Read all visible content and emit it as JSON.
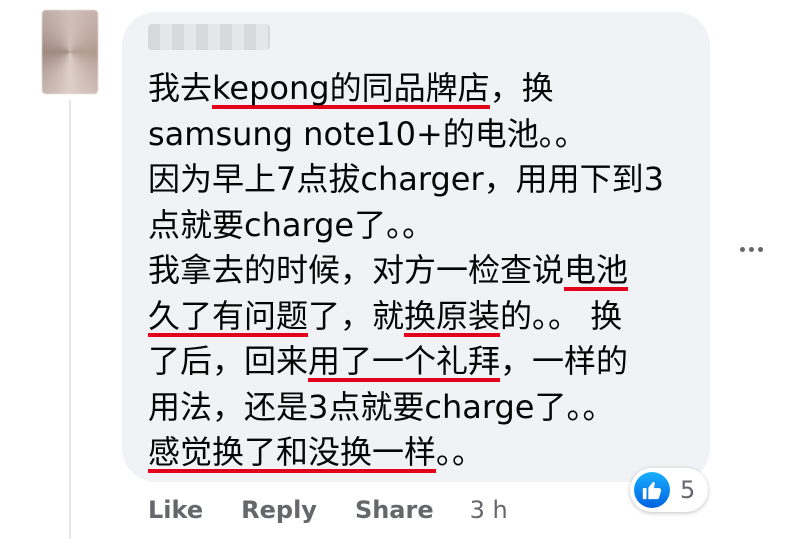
{
  "comment": {
    "author_name": "",
    "lines": [
      [
        {
          "t": "我去"
        },
        {
          "t": "kepong的同品牌店",
          "u": true
        },
        {
          "t": "，换"
        }
      ],
      [
        {
          "t": "samsung note10+的电池。。"
        }
      ],
      [
        {
          "t": "因为早上7点拔charger，用用下到3"
        }
      ],
      [
        {
          "t": "点就要charge了。。"
        }
      ],
      [
        {
          "t": "我拿去的时候，对方一检查说"
        },
        {
          "t": "电池",
          "u": true
        }
      ],
      [
        {
          "t": "久了有问题",
          "u": true
        },
        {
          "t": "了，就"
        },
        {
          "t": "换原装",
          "u": true
        },
        {
          "t": "的。。 换"
        }
      ],
      [
        {
          "t": "了后，回来"
        },
        {
          "t": "用了一个礼拜",
          "u": true
        },
        {
          "t": "，一样的"
        }
      ],
      [
        {
          "t": "用法，还是3点就要charge了。。"
        }
      ],
      [
        {
          "t": "感觉换了和没换一样",
          "u": true
        },
        {
          "t": "。。"
        }
      ]
    ]
  },
  "actions": {
    "like": "Like",
    "reply": "Reply",
    "share": "Share",
    "time": "3 h"
  },
  "reactions": {
    "icon": "like-reaction-icon",
    "count": "5"
  },
  "colors": {
    "bubble": "#f0f2f5",
    "underline": "#e3001b",
    "like_badge": "#0866ff",
    "muted_text": "#65676b"
  }
}
